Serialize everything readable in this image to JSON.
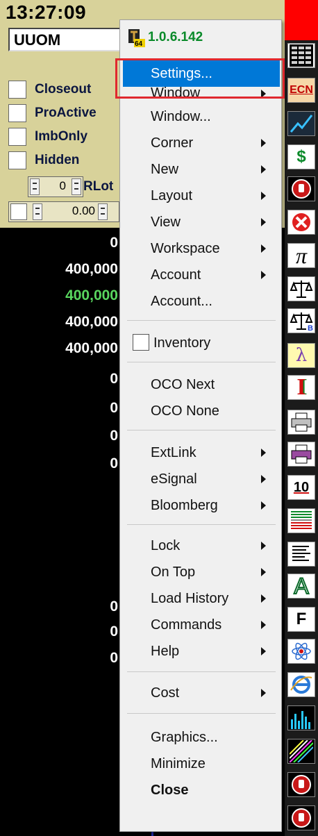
{
  "window": {
    "clock": "13:27:09",
    "symbol": "UUOM",
    "options": [
      "Closeout",
      "ProActive",
      "ImbOnly",
      "Hidden"
    ],
    "rlot_value": "0",
    "rlot_label": "RLot",
    "price_value": "0.00",
    "values": [
      {
        "text": "0",
        "color": "white"
      },
      {
        "text": "400,000",
        "color": "white"
      },
      {
        "text": "400,000",
        "color": "green"
      },
      {
        "text": "400,000",
        "color": "white"
      },
      {
        "text": "400,000",
        "color": "white"
      },
      {
        "text": "0",
        "color": "white"
      },
      {
        "text": "0",
        "color": "white"
      },
      {
        "text": "0",
        "color": "white"
      },
      {
        "text": "0",
        "color": "white"
      },
      {
        "text": "0",
        "color": "white"
      },
      {
        "text": "0",
        "color": "white"
      },
      {
        "text": "0",
        "color": "white"
      }
    ]
  },
  "menu": {
    "icon_badge": "64",
    "version": "1.0.6.142",
    "items": {
      "settings": "Settings...",
      "window": "Window",
      "window_dialog": "Window...",
      "corner": "Corner",
      "new": "New",
      "layout": "Layout",
      "view": "View",
      "workspace": "Workspace",
      "account": "Account",
      "account_dialog": "Account...",
      "inventory": "Inventory",
      "oco_next": "OCO Next",
      "oco_none": "OCO None",
      "extlink": "ExtLink",
      "esignal": "eSignal",
      "bloomberg": "Bloomberg",
      "lock": "Lock",
      "on_top": "On Top",
      "load_history": "Load History",
      "commands": "Commands",
      "help": "Help",
      "cost": "Cost",
      "graphics": "Graphics...",
      "minimize": "Minimize",
      "close": "Close"
    },
    "selected_color": "#0078d7",
    "highlight_color": "#e0282e"
  },
  "toolbar": {
    "ecn_label": "ECN",
    "dollar_label": "$",
    "pi_label": "π",
    "lambda_label": "λ",
    "i_label": "I",
    "ten_label": "10",
    "a_label": "A",
    "f_label": "F",
    "balance_b_label": "B",
    "icons": [
      "grid-icon",
      "ecn-icon",
      "chart-icon",
      "dollar-icon",
      "stop-icon",
      "cancel-icon",
      "pi-icon",
      "balance-icon",
      "balance-b-icon",
      "lambda-icon",
      "i-icon",
      "printer-icon",
      "printer-color-icon",
      "ten-icon",
      "level-grid-icon",
      "lines-icon",
      "a-icon",
      "f-icon",
      "atom-icon",
      "ie-icon",
      "bars-icon",
      "stripes-icon",
      "stop-icon",
      "stop-icon"
    ]
  }
}
